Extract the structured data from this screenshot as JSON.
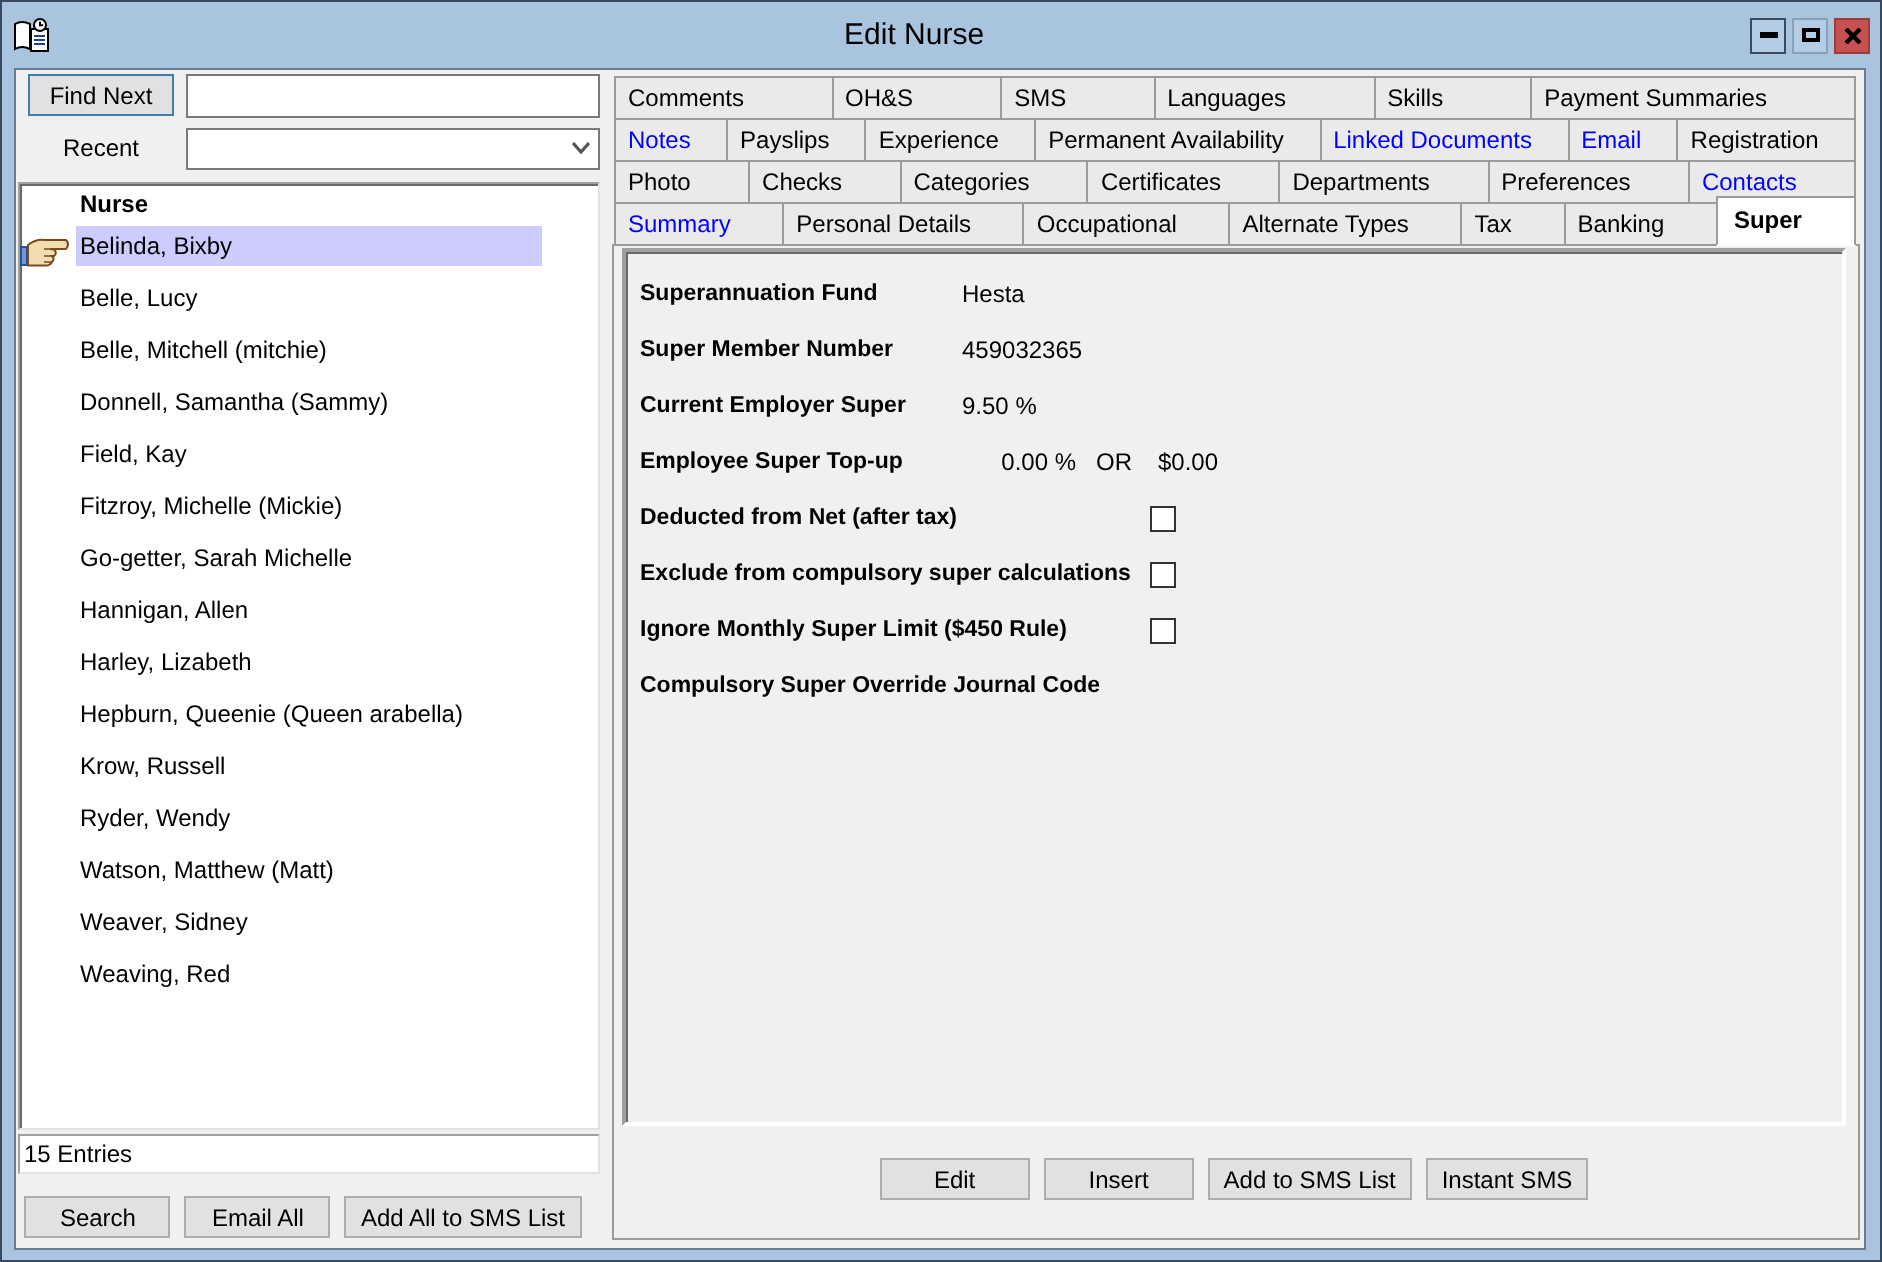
{
  "window": {
    "title": "Edit Nurse"
  },
  "search": {
    "find_button": "Find Next",
    "recent_label": "Recent"
  },
  "nurse_list": {
    "header": "Nurse",
    "rows": [
      {
        "name": "Belinda, Bixby",
        "selected": true
      },
      {
        "name": "Belle, Lucy",
        "selected": false
      },
      {
        "name": "Belle, Mitchell (mitchie)",
        "selected": false
      },
      {
        "name": "Donnell, Samantha (Sammy)",
        "selected": false
      },
      {
        "name": "Field, Kay",
        "selected": false
      },
      {
        "name": "Fitzroy, Michelle (Mickie)",
        "selected": false
      },
      {
        "name": "Go-getter, Sarah Michelle",
        "selected": false
      },
      {
        "name": "Hannigan, Allen",
        "selected": false
      },
      {
        "name": "Harley, Lizabeth",
        "selected": false
      },
      {
        "name": "Hepburn, Queenie (Queen arabella)",
        "selected": false
      },
      {
        "name": "Krow, Russell",
        "selected": false
      },
      {
        "name": "Ryder, Wendy",
        "selected": false
      },
      {
        "name": "Watson, Matthew (Matt)",
        "selected": false
      },
      {
        "name": "Weaver, Sidney",
        "selected": false
      },
      {
        "name": "Weaving, Red",
        "selected": false
      }
    ]
  },
  "entry_count": "15 Entries",
  "left_buttons": [
    "Search",
    "Email All",
    "Add All to SMS List"
  ],
  "tab_rows": [
    [
      {
        "label": "Comments",
        "selected": false,
        "highlighted": false
      },
      {
        "label": "OH&S",
        "selected": false,
        "highlighted": false
      },
      {
        "label": "SMS",
        "selected": false,
        "highlighted": false
      },
      {
        "label": "Languages",
        "selected": false,
        "highlighted": false
      },
      {
        "label": "Skills",
        "selected": false,
        "highlighted": false
      },
      {
        "label": "Payment Summaries",
        "selected": false,
        "highlighted": false
      }
    ],
    [
      {
        "label": "Notes",
        "selected": false,
        "highlighted": true
      },
      {
        "label": "Payslips",
        "selected": false,
        "highlighted": false
      },
      {
        "label": "Experience",
        "selected": false,
        "highlighted": false
      },
      {
        "label": "Permanent Availability",
        "selected": false,
        "highlighted": false
      },
      {
        "label": "Linked Documents",
        "selected": false,
        "highlighted": true
      },
      {
        "label": "Email",
        "selected": false,
        "highlighted": true
      },
      {
        "label": "Registration",
        "selected": false,
        "highlighted": false
      }
    ],
    [
      {
        "label": "Photo",
        "selected": false,
        "highlighted": false
      },
      {
        "label": "Checks",
        "selected": false,
        "highlighted": false
      },
      {
        "label": "Categories",
        "selected": false,
        "highlighted": false
      },
      {
        "label": "Certificates",
        "selected": false,
        "highlighted": false
      },
      {
        "label": "Departments",
        "selected": false,
        "highlighted": false
      },
      {
        "label": "Preferences",
        "selected": false,
        "highlighted": false
      },
      {
        "label": "Contacts",
        "selected": false,
        "highlighted": true
      }
    ],
    [
      {
        "label": "Summary",
        "selected": false,
        "highlighted": true
      },
      {
        "label": "Personal Details",
        "selected": false,
        "highlighted": false
      },
      {
        "label": "Occupational",
        "selected": false,
        "highlighted": false
      },
      {
        "label": "Alternate Types",
        "selected": false,
        "highlighted": false
      },
      {
        "label": "Tax",
        "selected": false,
        "highlighted": false
      },
      {
        "label": "Banking",
        "selected": false,
        "highlighted": false
      },
      {
        "label": "Super",
        "selected": true,
        "highlighted": false
      }
    ]
  ],
  "super_fields": [
    {
      "kind": "text",
      "label": "Superannuation Fund",
      "value": "Hesta"
    },
    {
      "kind": "text",
      "label": "Super Member Number",
      "value": "459032365"
    },
    {
      "kind": "text",
      "label": "Current Employer Super",
      "value": "9.50 %"
    },
    {
      "kind": "topup",
      "label": "Employee Super Top-up",
      "percent": "0.00 %",
      "separator": "OR",
      "amount": "$0.00"
    },
    {
      "kind": "checkbox",
      "label": "Deducted from Net (after tax)",
      "checked": false
    },
    {
      "kind": "checkbox",
      "label": "Exclude from compulsory super calculations",
      "checked": false
    },
    {
      "kind": "checkbox",
      "label": "Ignore Monthly Super Limit ($450 Rule)",
      "checked": false
    },
    {
      "kind": "label",
      "label": "Compulsory Super Override Journal Code"
    }
  ],
  "action_buttons": [
    "Edit",
    "Insert",
    "Add to SMS List",
    "Instant SMS"
  ]
}
